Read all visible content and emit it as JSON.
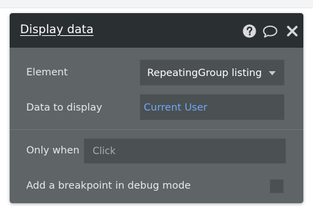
{
  "panel": {
    "title": "Display data",
    "icons": [
      "help-icon",
      "comment-icon",
      "close-icon"
    ]
  },
  "fields": {
    "element_label": "Element",
    "element_value": "RepeatingGroup listing",
    "data_label": "Data to display",
    "data_value": "Current User",
    "only_when_label": "Only when",
    "only_when_placeholder": "Click",
    "breakpoint_label": "Add a breakpoint in debug mode",
    "breakpoint_checked": false
  },
  "colors": {
    "header_bg": "#2a2f31",
    "panel_bg": "#5f6466",
    "field_bg": "#4b5052",
    "link_blue": "#6ea8f7"
  }
}
